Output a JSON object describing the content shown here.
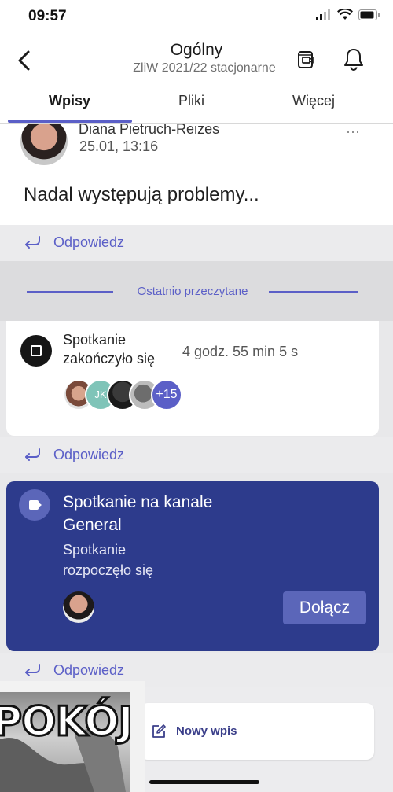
{
  "status_bar": {
    "time": "09:57"
  },
  "header": {
    "title": "Ogólny",
    "subtitle": "ZliW 2021/22  stacjonarne",
    "tabs": [
      {
        "label": "Wpisy",
        "active": true
      },
      {
        "label": "Pliki",
        "active": false
      },
      {
        "label": "Więcej",
        "active": false
      }
    ]
  },
  "post": {
    "author": "Diana Pietruch-Reizes",
    "time": "25.01, 13:16",
    "body": "Nadal występują problemy...",
    "more_icon": "⋯"
  },
  "reply_label": "Odpowiedz",
  "last_read_label": "Ostatnio przeczytane",
  "meeting_ended": {
    "title": "Spotkanie zakończyło się",
    "duration": "4 godz. 55 min 5 s",
    "participants": [
      {
        "initials": ""
      },
      {
        "initials": "JK"
      },
      {
        "initials": ""
      },
      {
        "initials": ""
      }
    ],
    "overflow_count": "+15"
  },
  "meeting_started": {
    "title": "Spotkanie na kanale General",
    "status": "Spotkanie rozpoczęło się",
    "join_label": "Dołącz"
  },
  "compose": {
    "new_post_label": "Nowy wpis"
  },
  "meme": {
    "text": "POKÓJ"
  },
  "colors": {
    "accent": "#5b5fc7",
    "meeting_card": "#2d3b8c",
    "join_button": "#5b66b9"
  }
}
